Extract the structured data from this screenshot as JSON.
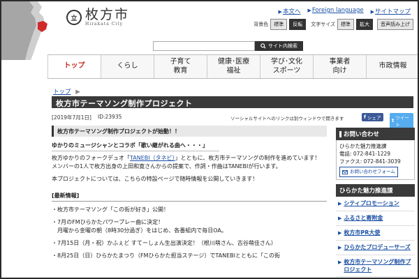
{
  "header": {
    "logo_seal": "立",
    "logo_jp": "枚方市",
    "logo_en": "Hirakata City",
    "links": [
      "本文へ",
      "Foreign language",
      "サイトマップ"
    ],
    "bg_label": "背景色",
    "bg_standard": "標準",
    "bg_invert": "反転",
    "text_size_label": "文字サイズ",
    "size_standard": "標準",
    "size_large": "拡大",
    "read_aloud": "音声読み上げ",
    "search_button": "サイト内検索"
  },
  "nav": [
    {
      "label": "トップ",
      "active": true
    },
    {
      "label": "くらし",
      "active": false
    },
    {
      "label": "子育て\n教育",
      "active": false
    },
    {
      "label": "健康･医療\n福祉",
      "active": false
    },
    {
      "label": "学び･文化\nスポーツ",
      "active": false
    },
    {
      "label": "事業者\n向け",
      "active": false
    },
    {
      "label": "市政情報",
      "active": false
    }
  ],
  "breadcrumb": {
    "home": "トップ",
    "sep": "▶"
  },
  "page": {
    "title": "枚方市テーマソング制作プロジェクト",
    "date": "[2019年7月1日]",
    "id": "ID:23935",
    "social_note": "ソーシャルサイトへのリンクは別ウィンドウで開きます",
    "share_fb": "シェア",
    "share_tw": "ツイート"
  },
  "content": {
    "h2": "枚方市テーマソング制作プロジェクトが始動！！",
    "h3": "ゆかりのミュージシャンとコラボ「歌い継がれる曲へ・・・」",
    "p1_a": "枚方ゆかりのフォークデュオ「",
    "p1_link": "TANEBI（タネビ）",
    "p1_b": "」とともに、枚方市テーマソングの制作を進めています！",
    "p2": "メンバーの1人で枚方出身の上田和寛さんからの提案で、作詞・作曲はTANEBIが行います。",
    "p3": "本プロジェクトについては、こちらの特設ページで随時情報を公開していきます！",
    "news_head": "[最新情報]",
    "news": [
      {
        "line": "・枚方市テーマソング「この街が好き」公開！",
        "sub": ""
      },
      {
        "line": "・7月のFMひらかたパワープレー曲に決定！",
        "sub": "月曜から金曜の朝（8時30分過ぎ）をはじめ、各番組内で毎日OA。"
      },
      {
        "line": "・7月15日（月・祝）かふぇど すてーしょん生出演決定！（根川萌さん、古谷萌佳さん）",
        "sub": ""
      },
      {
        "line": "・8月25日（日）ひらかたまつり（FMひらかた担当ステージ）でTANEBIとともに「この街",
        "sub": ""
      }
    ]
  },
  "sidebar": {
    "contact_head": "お問い合わせ",
    "dept": "ひらかた魅力推進課",
    "tel": "電話: 072-841-1229",
    "fax": "ファクス: 072-841-3039",
    "mail_button": "お問い合わせフォーム",
    "section_head": "ひらかた魅力推進課",
    "links": [
      "シティプロモーション",
      "ふるさと寄附金",
      "枚方市PR大使",
      "ひらかたプロデューサーズ",
      "枚方市テーマソング制作プロジェクト"
    ]
  },
  "colors": {
    "accent": "#c8271e",
    "link": "#1a4fa3",
    "dark": "#3a3a3a"
  }
}
